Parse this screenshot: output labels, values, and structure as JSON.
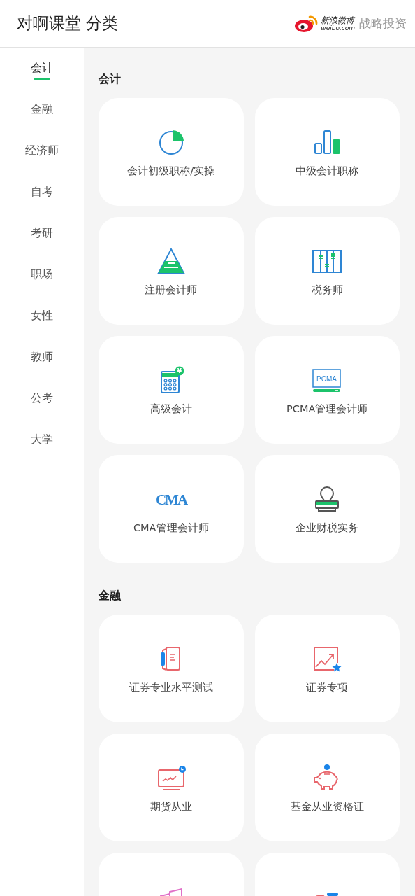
{
  "header": {
    "title": "对啊课堂 分类",
    "sponsor": {
      "brand_cn": "新浪微博",
      "brand_url": "weibo.com",
      "label": "战略投资"
    }
  },
  "sidebar": {
    "items": [
      {
        "label": "会计",
        "selected": true
      },
      {
        "label": "金融",
        "selected": false
      },
      {
        "label": "经济师",
        "selected": false
      },
      {
        "label": "自考",
        "selected": false
      },
      {
        "label": "考研",
        "selected": false
      },
      {
        "label": "职场",
        "selected": false
      },
      {
        "label": "女性",
        "selected": false
      },
      {
        "label": "教师",
        "selected": false
      },
      {
        "label": "公考",
        "selected": false
      },
      {
        "label": "大学",
        "selected": false
      }
    ]
  },
  "sections": [
    {
      "title": "会计",
      "cards": [
        {
          "kind": "pie",
          "label": "会计初级职称/实操"
        },
        {
          "kind": "bars",
          "label": "中级会计职称"
        },
        {
          "kind": "pyramid",
          "label": "注册会计师"
        },
        {
          "kind": "abacus",
          "label": "税务师"
        },
        {
          "kind": "calculator",
          "label": "高级会计",
          "icon_text": "¥"
        },
        {
          "kind": "screen",
          "label": "PCMA管理会计师",
          "icon_text": "PCMA"
        },
        {
          "kind": "logo",
          "label": "CMA管理会计师",
          "icon_text": "CMA"
        },
        {
          "kind": "stamp",
          "label": "企业财税实务"
        }
      ]
    },
    {
      "title": "金融",
      "cards": [
        {
          "kind": "book",
          "label": "证券专业水平测试"
        },
        {
          "kind": "chart-star",
          "label": "证券专项"
        },
        {
          "kind": "monitor",
          "label": "期货从业"
        },
        {
          "kind": "piggy",
          "label": "基金从业资格证"
        },
        {
          "kind": "documents"
        },
        {
          "kind": "folder"
        }
      ]
    }
  ]
}
